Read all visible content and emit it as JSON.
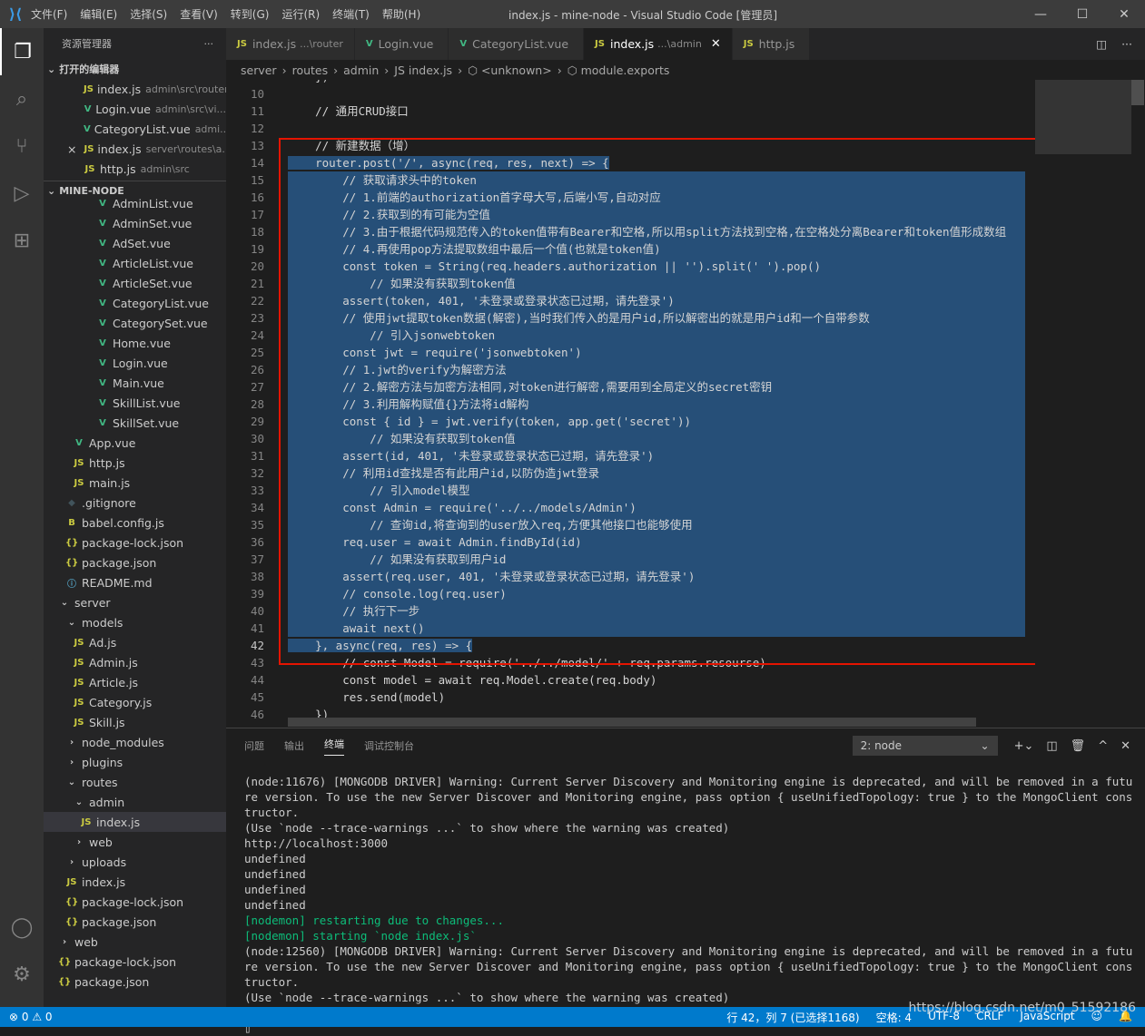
{
  "window": {
    "title": "index.js - mine-node - Visual Studio Code [管理员]",
    "menu": [
      "文件(F)",
      "编辑(E)",
      "选择(S)",
      "查看(V)",
      "转到(G)",
      "运行(R)",
      "终端(T)",
      "帮助(H)"
    ]
  },
  "sidebar": {
    "title": "资源管理器",
    "open_editors_header": "打开的编辑器",
    "open_editors": [
      {
        "icon": "JS",
        "type": "js",
        "name": "index.js",
        "desc": "admin\\src\\router"
      },
      {
        "icon": "V",
        "type": "vue",
        "name": "Login.vue",
        "desc": "admin\\src\\vi..."
      },
      {
        "icon": "V",
        "type": "vue",
        "name": "CategoryList.vue",
        "desc": "admi..."
      },
      {
        "icon": "JS",
        "type": "js",
        "name": "index.js",
        "desc": "server\\routes\\a...",
        "close": "×"
      },
      {
        "icon": "JS",
        "type": "js",
        "name": "http.js",
        "desc": "admin\\src"
      }
    ],
    "project_header": "MINE-NODE",
    "tree": [
      {
        "indent": 58,
        "icon": "V",
        "type": "vue",
        "name": "AdminList.vue"
      },
      {
        "indent": 58,
        "icon": "V",
        "type": "vue",
        "name": "AdminSet.vue"
      },
      {
        "indent": 58,
        "icon": "V",
        "type": "vue",
        "name": "AdSet.vue"
      },
      {
        "indent": 58,
        "icon": "V",
        "type": "vue",
        "name": "ArticleList.vue"
      },
      {
        "indent": 58,
        "icon": "V",
        "type": "vue",
        "name": "ArticleSet.vue"
      },
      {
        "indent": 58,
        "icon": "V",
        "type": "vue",
        "name": "CategoryList.vue"
      },
      {
        "indent": 58,
        "icon": "V",
        "type": "vue",
        "name": "CategorySet.vue"
      },
      {
        "indent": 58,
        "icon": "V",
        "type": "vue",
        "name": "Home.vue"
      },
      {
        "indent": 58,
        "icon": "V",
        "type": "vue",
        "name": "Login.vue"
      },
      {
        "indent": 58,
        "icon": "V",
        "type": "vue",
        "name": "Main.vue"
      },
      {
        "indent": 58,
        "icon": "V",
        "type": "vue",
        "name": "SkillList.vue"
      },
      {
        "indent": 58,
        "icon": "V",
        "type": "vue",
        "name": "SkillSet.vue"
      },
      {
        "indent": 32,
        "icon": "V",
        "type": "vue",
        "name": "App.vue"
      },
      {
        "indent": 32,
        "icon": "JS",
        "type": "js",
        "name": "http.js"
      },
      {
        "indent": 32,
        "icon": "JS",
        "type": "js",
        "name": "main.js"
      },
      {
        "indent": 24,
        "icon": "◆",
        "type": "git",
        "name": ".gitignore"
      },
      {
        "indent": 24,
        "icon": "B",
        "type": "babel",
        "name": "babel.config.js"
      },
      {
        "indent": 24,
        "icon": "{}",
        "type": "json",
        "name": "package-lock.json"
      },
      {
        "indent": 24,
        "icon": "{}",
        "type": "json",
        "name": "package.json"
      },
      {
        "indent": 24,
        "icon": "ⓘ",
        "type": "info",
        "name": "README.md"
      },
      {
        "indent": 16,
        "icon": "⌄",
        "type": "folder",
        "name": "server"
      },
      {
        "indent": 24,
        "icon": "⌄",
        "type": "folder",
        "name": "models"
      },
      {
        "indent": 32,
        "icon": "JS",
        "type": "js",
        "name": "Ad.js"
      },
      {
        "indent": 32,
        "icon": "JS",
        "type": "js",
        "name": "Admin.js"
      },
      {
        "indent": 32,
        "icon": "JS",
        "type": "js",
        "name": "Article.js"
      },
      {
        "indent": 32,
        "icon": "JS",
        "type": "js",
        "name": "Category.js"
      },
      {
        "indent": 32,
        "icon": "JS",
        "type": "js",
        "name": "Skill.js"
      },
      {
        "indent": 24,
        "icon": "›",
        "type": "folder",
        "name": "node_modules"
      },
      {
        "indent": 24,
        "icon": "›",
        "type": "folder",
        "name": "plugins"
      },
      {
        "indent": 24,
        "icon": "⌄",
        "type": "folder",
        "name": "routes"
      },
      {
        "indent": 32,
        "icon": "⌄",
        "type": "folder",
        "name": "admin"
      },
      {
        "indent": 40,
        "icon": "JS",
        "type": "js",
        "name": "index.js",
        "selected": true
      },
      {
        "indent": 32,
        "icon": "›",
        "type": "folder",
        "name": "web"
      },
      {
        "indent": 24,
        "icon": "›",
        "type": "folder",
        "name": "uploads"
      },
      {
        "indent": 24,
        "icon": "JS",
        "type": "js",
        "name": "index.js"
      },
      {
        "indent": 24,
        "icon": "{}",
        "type": "json",
        "name": "package-lock.json"
      },
      {
        "indent": 24,
        "icon": "{}",
        "type": "json",
        "name": "package.json"
      },
      {
        "indent": 16,
        "icon": "›",
        "type": "folder",
        "name": "web"
      },
      {
        "indent": 16,
        "icon": "{}",
        "type": "json",
        "name": "package-lock.json"
      },
      {
        "indent": 16,
        "icon": "{}",
        "type": "json",
        "name": "package.json"
      }
    ]
  },
  "tabs": [
    {
      "icon": "JS",
      "type": "js",
      "name": "index.js",
      "desc": "...\\router"
    },
    {
      "icon": "V",
      "type": "vue",
      "name": "Login.vue",
      "desc": ""
    },
    {
      "icon": "V",
      "type": "vue",
      "name": "CategoryList.vue",
      "desc": ""
    },
    {
      "icon": "JS",
      "type": "js",
      "name": "index.js",
      "desc": "...\\admin",
      "active": true
    },
    {
      "icon": "JS",
      "type": "js",
      "name": "http.js",
      "desc": ""
    }
  ],
  "breadcrumb": [
    "server",
    "routes",
    "admin",
    "JS index.js",
    "⬡ <unknown>",
    "⬡ module.exports"
  ],
  "editor": {
    "first_line": 10,
    "current_line": 42,
    "lines": [
      {
        "text": "    })",
        "hl": false
      },
      {
        "text": "",
        "hl": false
      },
      {
        "text": "    // 通用CRUD接口",
        "hl": false
      },
      {
        "text": "",
        "hl": false
      },
      {
        "text": "    // 新建数据（增）",
        "hl": false
      },
      {
        "text": "    router.post('/', async(req, res, next) => {",
        "hl": "partial"
      },
      {
        "text": "        // 获取请求头中的token",
        "hl": true
      },
      {
        "text": "        // 1.前端的authorization首字母大写,后端小写,自动对应",
        "hl": true
      },
      {
        "text": "        // 2.获取到的有可能为空值",
        "hl": true
      },
      {
        "text": "        // 3.由于根据代码规范传入的token值带有Bearer和空格,所以用split方法找到空格,在空格处分离Bearer和token值形成数组",
        "hl": true
      },
      {
        "text": "        // 4.再使用pop方法提取数组中最后一个值(也就是token值)",
        "hl": true
      },
      {
        "text": "        const token = String(req.headers.authorization || '').split(' ').pop()",
        "hl": true
      },
      {
        "text": "            // 如果没有获取到token值",
        "hl": true
      },
      {
        "text": "        assert(token, 401, '未登录或登录状态已过期，请先登录')",
        "hl": true
      },
      {
        "text": "        // 使用jwt提取token数据(解密),当时我们传入的是用户id,所以解密出的就是用户id和一个自带参数",
        "hl": true
      },
      {
        "text": "            // 引入jsonwebtoken",
        "hl": true
      },
      {
        "text": "        const jwt = require('jsonwebtoken')",
        "hl": true
      },
      {
        "text": "        // 1.jwt的verify为解密方法",
        "hl": true
      },
      {
        "text": "        // 2.解密方法与加密方法相同,对token进行解密,需要用到全局定义的secret密钥",
        "hl": true
      },
      {
        "text": "        // 3.利用解构赋值{}方法将id解构",
        "hl": true
      },
      {
        "text": "        const { id } = jwt.verify(token, app.get('secret'))",
        "hl": true
      },
      {
        "text": "            // 如果没有获取到token值",
        "hl": true
      },
      {
        "text": "        assert(id, 401, '未登录或登录状态已过期，请先登录')",
        "hl": true
      },
      {
        "text": "        // 利用id查找是否有此用户id,以防伪造jwt登录",
        "hl": true
      },
      {
        "text": "            // 引入model模型",
        "hl": true
      },
      {
        "text": "        const Admin = require('../../models/Admin')",
        "hl": true
      },
      {
        "text": "            // 查询id,将查询到的user放入req,方便其他接口也能够使用",
        "hl": true
      },
      {
        "text": "        req.user = await Admin.findById(id)",
        "hl": true
      },
      {
        "text": "            // 如果没有获取到用户id",
        "hl": true
      },
      {
        "text": "        assert(req.user, 401, '未登录或登录状态已过期，请先登录')",
        "hl": true
      },
      {
        "text": "        // console.log(req.user)",
        "hl": true
      },
      {
        "text": "        // 执行下一步",
        "hl": true
      },
      {
        "text": "        await next()",
        "hl": true
      },
      {
        "text": "    }, async(req, res) => {",
        "hl": "partial2"
      },
      {
        "text": "        // const Model = require('../../model/' + req.params.resourse)",
        "hl": false
      },
      {
        "text": "        const model = await req.Model.create(req.body)",
        "hl": false
      },
      {
        "text": "        res.send(model)",
        "hl": false
      },
      {
        "text": "    })",
        "hl": false
      }
    ]
  },
  "panel": {
    "tabs": [
      "问题",
      "输出",
      "终端",
      "调试控制台"
    ],
    "active_tab": "终端",
    "terminal_select": "2: node",
    "actions": [
      "+⌄",
      "⊞",
      "🗑",
      "^",
      "×"
    ],
    "terminal_lines": [
      {
        "text": "(node:11676) [MONGODB DRIVER] Warning: Current Server Discovery and Monitoring engine is deprecated, and will be removed in a future version. To use the new Server Discover and Monitoring engine, pass option { useUnifiedTopology: true } to the MongoClient constructor.",
        "green": false
      },
      {
        "text": "(Use `node --trace-warnings ...` to show where the warning was created)",
        "green": false
      },
      {
        "text": "http://localhost:3000",
        "green": false
      },
      {
        "text": "undefined",
        "green": false
      },
      {
        "text": "undefined",
        "green": false
      },
      {
        "text": "undefined",
        "green": false
      },
      {
        "text": "undefined",
        "green": false
      },
      {
        "text": "[nodemon] restarting due to changes...",
        "green": true
      },
      {
        "text": "[nodemon] starting `node index.js`",
        "green": true
      },
      {
        "text": "(node:12560) [MONGODB DRIVER] Warning: Current Server Discovery and Monitoring engine is deprecated, and will be removed in a future version. To use the new Server Discover and Monitoring engine, pass option { useUnifiedTopology: true } to the MongoClient constructor.",
        "green": false
      },
      {
        "text": "(Use `node --trace-warnings ...` to show where the warning was created)",
        "green": false
      },
      {
        "text": "http://localhost:3000",
        "green": false
      },
      {
        "text": "▯",
        "green": false
      }
    ]
  },
  "status": {
    "problems": "⊗ 0 ⚠ 0",
    "position": "行 42，列 7 (已选择1168)",
    "spaces": "空格: 4",
    "encoding": "UTF-8",
    "eol": "CRLF",
    "language": "JavaScript",
    "watermark": "https://blog.csdn.net/m0_51592186"
  }
}
